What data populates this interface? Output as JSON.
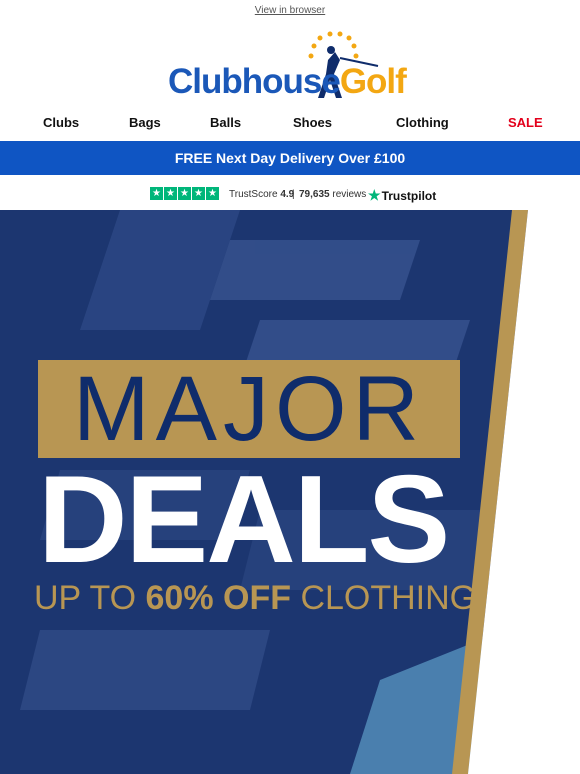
{
  "topbar": {
    "view_in_browser": "View in browser"
  },
  "logo": {
    "word1": "Clubhouse",
    "word2": "Golf"
  },
  "nav": {
    "items": [
      "Clubs",
      "Bags",
      "Balls",
      "Shoes",
      "Clothing",
      "SALE"
    ]
  },
  "banner": {
    "delivery": "FREE Next Day Delivery Over £100"
  },
  "trust": {
    "score_label": "TrustScore",
    "score": "4.9",
    "separator": "|",
    "reviews": "79,635",
    "reviews_label": "reviews",
    "brand": "Trustpilot"
  },
  "hero": {
    "line1": "MAJOR",
    "line2": "DEALS",
    "sub_prefix": "UP TO",
    "sub_highlight": "60% OFF",
    "sub_suffix": "CLOTHING"
  },
  "colors": {
    "brand_blue": "#1b58b8",
    "delivery_blue": "#0f55c3",
    "gold": "#b89653",
    "navy": "#0f2c6b",
    "sale_red": "#e3001b",
    "trust_green": "#00b67a"
  }
}
